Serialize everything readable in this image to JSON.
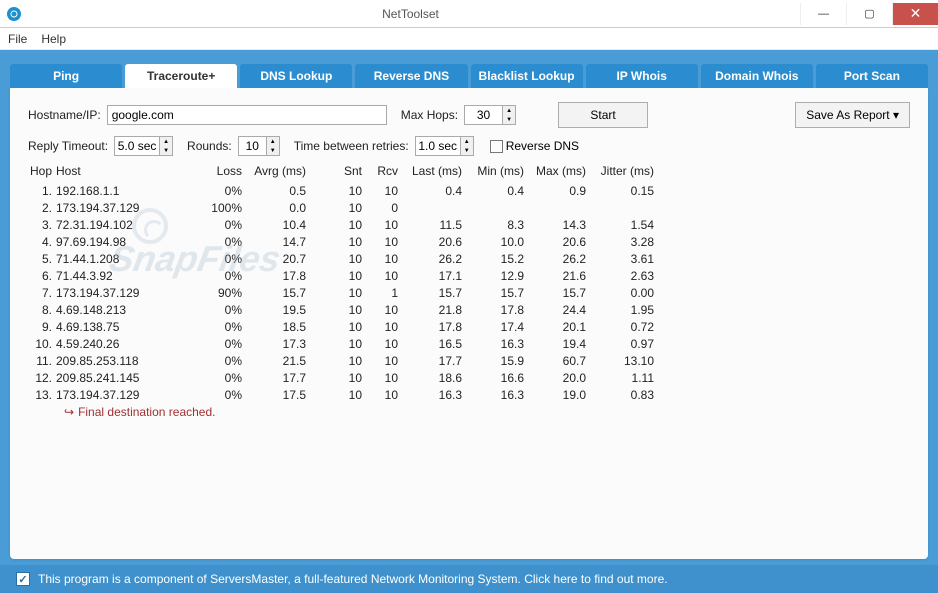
{
  "window": {
    "title": "NetToolset"
  },
  "winbuttons": {
    "min": "—",
    "max": "▢",
    "close": "✕"
  },
  "menu": {
    "file": "File",
    "help": "Help"
  },
  "tabs": [
    {
      "id": "ping",
      "label": "Ping",
      "active": false
    },
    {
      "id": "traceroute",
      "label": "Traceroute+",
      "active": true
    },
    {
      "id": "dns",
      "label": "DNS Lookup",
      "active": false
    },
    {
      "id": "revdns",
      "label": "Reverse DNS",
      "active": false
    },
    {
      "id": "blacklist",
      "label": "Blacklist Lookup",
      "active": false
    },
    {
      "id": "ipwhois",
      "label": "IP Whois",
      "active": false
    },
    {
      "id": "domwhois",
      "label": "Domain Whois",
      "active": false
    },
    {
      "id": "portscan",
      "label": "Port Scan",
      "active": false
    }
  ],
  "form": {
    "host_label": "Hostname/IP:",
    "host_value": "google.com",
    "maxhops_label": "Max Hops:",
    "maxhops_value": "30",
    "timeout_label": "Reply Timeout:",
    "timeout_value": "5.0 sec",
    "rounds_label": "Rounds:",
    "rounds_value": "10",
    "tbr_label": "Time between retries:",
    "tbr_value": "1.0 sec",
    "reverse_label": "Reverse DNS",
    "start_label": "Start",
    "save_label": "Save As Report ▾"
  },
  "columns": {
    "hop": "Hop",
    "host": "Host",
    "loss": "Loss",
    "avg": "Avrg (ms)",
    "snt": "Snt",
    "rcv": "Rcv",
    "last": "Last (ms)",
    "min": "Min (ms)",
    "max": "Max (ms)",
    "jitter": "Jitter (ms)"
  },
  "rows": [
    {
      "idx": "1.",
      "host": "192.168.1.1",
      "loss": "0%",
      "avg": "0.5",
      "snt": "10",
      "rcv": "10",
      "last": "0.4",
      "min": "0.4",
      "max": "0.9",
      "jit": "0.15"
    },
    {
      "idx": "2.",
      "host": "173.194.37.129",
      "loss": "100%",
      "avg": "0.0",
      "snt": "10",
      "rcv": "0",
      "last": "",
      "min": "",
      "max": "",
      "jit": ""
    },
    {
      "idx": "3.",
      "host": "72.31.194.102",
      "loss": "0%",
      "avg": "10.4",
      "snt": "10",
      "rcv": "10",
      "last": "11.5",
      "min": "8.3",
      "max": "14.3",
      "jit": "1.54"
    },
    {
      "idx": "4.",
      "host": "97.69.194.98",
      "loss": "0%",
      "avg": "14.7",
      "snt": "10",
      "rcv": "10",
      "last": "20.6",
      "min": "10.0",
      "max": "20.6",
      "jit": "3.28"
    },
    {
      "idx": "5.",
      "host": "71.44.1.208",
      "loss": "0%",
      "avg": "20.7",
      "snt": "10",
      "rcv": "10",
      "last": "26.2",
      "min": "15.2",
      "max": "26.2",
      "jit": "3.61"
    },
    {
      "idx": "6.",
      "host": "71.44.3.92",
      "loss": "0%",
      "avg": "17.8",
      "snt": "10",
      "rcv": "10",
      "last": "17.1",
      "min": "12.9",
      "max": "21.6",
      "jit": "2.63"
    },
    {
      "idx": "7.",
      "host": "173.194.37.129",
      "loss": "90%",
      "avg": "15.7",
      "snt": "10",
      "rcv": "1",
      "last": "15.7",
      "min": "15.7",
      "max": "15.7",
      "jit": "0.00"
    },
    {
      "idx": "8.",
      "host": "4.69.148.213",
      "loss": "0%",
      "avg": "19.5",
      "snt": "10",
      "rcv": "10",
      "last": "21.8",
      "min": "17.8",
      "max": "24.4",
      "jit": "1.95"
    },
    {
      "idx": "9.",
      "host": "4.69.138.75",
      "loss": "0%",
      "avg": "18.5",
      "snt": "10",
      "rcv": "10",
      "last": "17.8",
      "min": "17.4",
      "max": "20.1",
      "jit": "0.72"
    },
    {
      "idx": "10.",
      "host": "4.59.240.26",
      "loss": "0%",
      "avg": "17.3",
      "snt": "10",
      "rcv": "10",
      "last": "16.5",
      "min": "16.3",
      "max": "19.4",
      "jit": "0.97"
    },
    {
      "idx": "11.",
      "host": "209.85.253.118",
      "loss": "0%",
      "avg": "21.5",
      "snt": "10",
      "rcv": "10",
      "last": "17.7",
      "min": "15.9",
      "max": "60.7",
      "jit": "13.10"
    },
    {
      "idx": "12.",
      "host": "209.85.241.145",
      "loss": "0%",
      "avg": "17.7",
      "snt": "10",
      "rcv": "10",
      "last": "18.6",
      "min": "16.6",
      "max": "20.0",
      "jit": "1.11"
    },
    {
      "idx": "13.",
      "host": "173.194.37.129",
      "loss": "0%",
      "avg": "17.5",
      "snt": "10",
      "rcv": "10",
      "last": "16.3",
      "min": "16.3",
      "max": "19.0",
      "jit": "0.83"
    }
  ],
  "final_msg": "Final destination reached.",
  "footer": {
    "text": "This program is a component of ServersMaster, a full-featured Network Monitoring System. Click here to find out more."
  }
}
